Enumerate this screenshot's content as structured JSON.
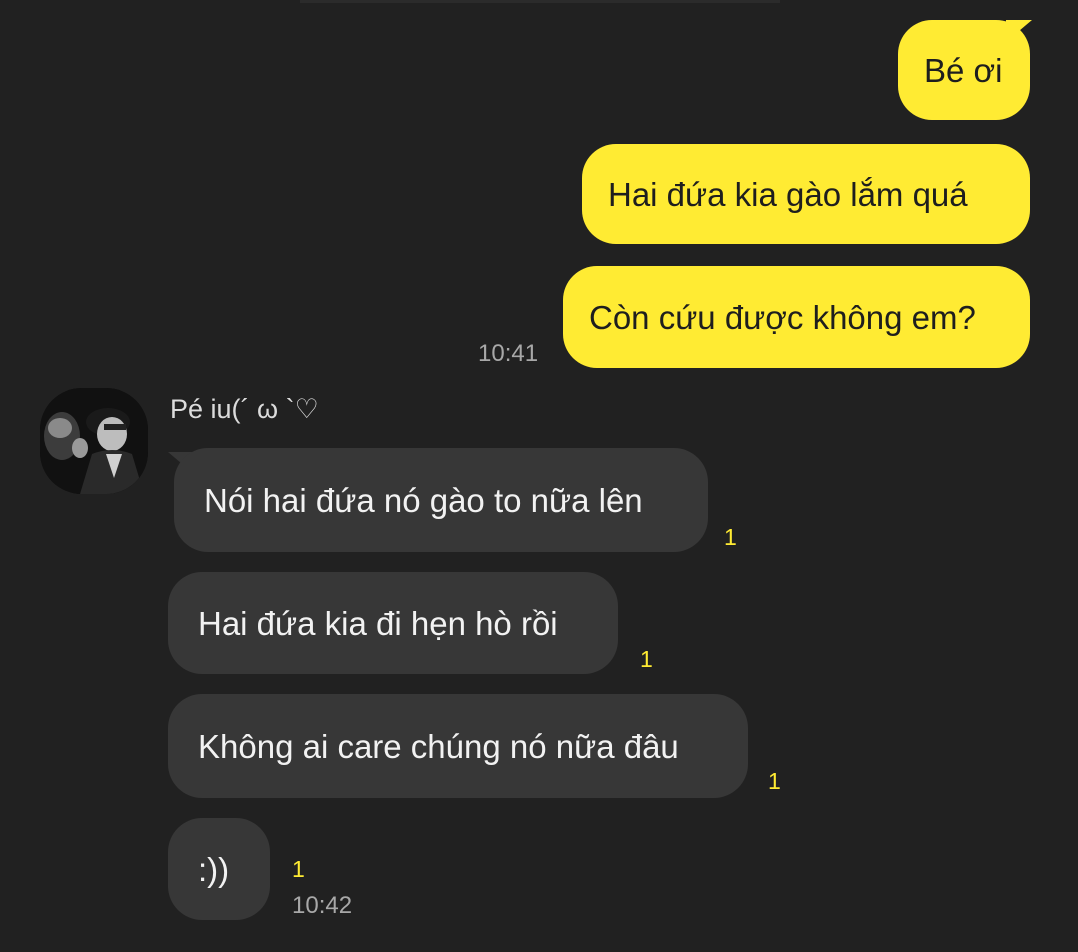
{
  "colors": {
    "background": "#212121",
    "outgoing_bubble": "#ffeb33",
    "incoming_bubble": "#373737",
    "unread_count": "#ffeb33",
    "timestamp": "#a8a8a8"
  },
  "outgoing": {
    "messages": [
      "Bé ơi",
      "Hai đứa kia gào lắm quá",
      "Còn cứu được không em?"
    ],
    "time": "10:41"
  },
  "incoming": {
    "sender_name": "Pé iu(´ ω `♡",
    "avatar_icon": "profile-photo",
    "messages": [
      {
        "text": "Nói hai đứa nó gào to nữa lên",
        "unread": "1"
      },
      {
        "text": "Hai đứa kia đi hẹn hò rồi",
        "unread": "1"
      },
      {
        "text": "Không ai care chúng nó nữa đâu",
        "unread": "1"
      },
      {
        "text": ":))",
        "unread": "1"
      }
    ],
    "time": "10:42"
  }
}
